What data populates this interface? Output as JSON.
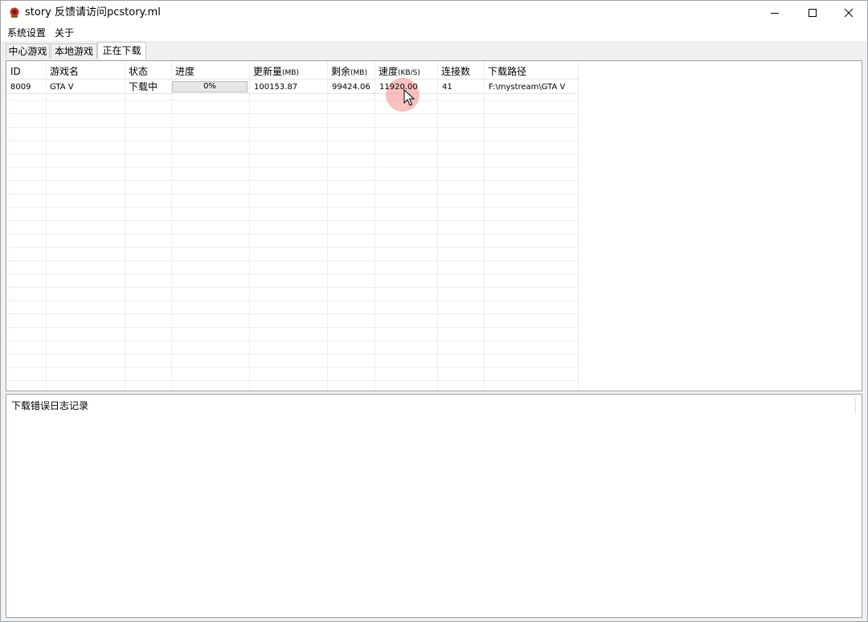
{
  "window": {
    "title": "story 反馈请访问pcstory.ml"
  },
  "menu": {
    "items": [
      "系统设置",
      "关于"
    ]
  },
  "tabs": [
    {
      "label": "中心游戏",
      "active": false
    },
    {
      "label": "本地游戏",
      "active": false
    },
    {
      "label": "正在下载",
      "active": true
    }
  ],
  "table": {
    "headers": {
      "id": "ID",
      "name": "游戏名",
      "status": "状态",
      "progress": "进度",
      "update_main": "更新量",
      "update_unit": "(MB)",
      "remaining_main": "剩余",
      "remaining_unit": "(MB)",
      "speed_main": "速度",
      "speed_unit": "(KB/S)",
      "connections": "连接数",
      "path": "下载路径"
    },
    "rows": [
      {
        "id": "8009",
        "name": "GTA V",
        "status": "下载中",
        "progress_label": "0%",
        "progress_value": 0,
        "update": "100153.87",
        "remaining": "99424.06",
        "speed": "11920.00",
        "connections": "41",
        "path": "F:\\mystream\\GTA V"
      }
    ]
  },
  "log": {
    "title": "下载错误日志记录"
  },
  "colors": {
    "progress_fill": "#06b025",
    "cursor_highlight": "#f48c8c"
  },
  "icons": {
    "app": "app-icon",
    "minimize": "minimize-icon",
    "maximize": "maximize-icon",
    "close": "close-icon",
    "cursor": "mouse-cursor-icon"
  }
}
